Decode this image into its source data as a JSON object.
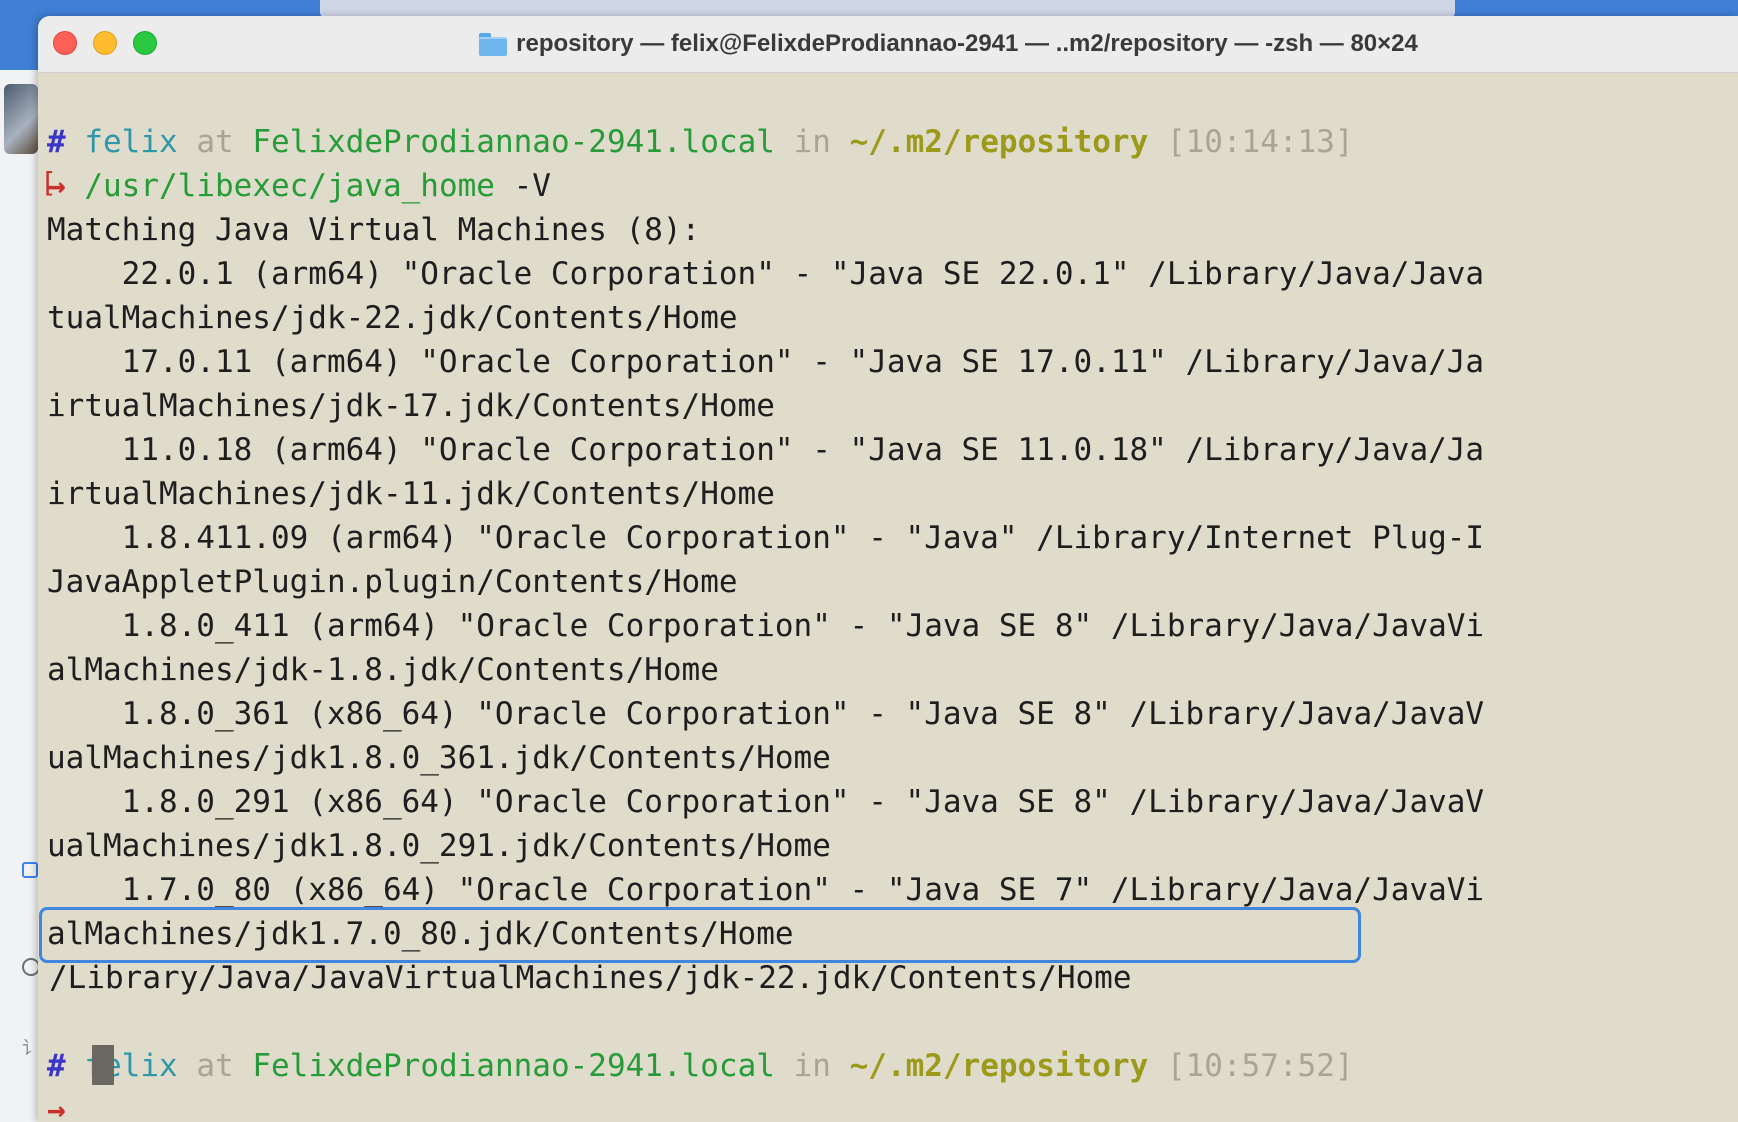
{
  "window": {
    "title": "repository — felix@FelixdeProdiannao-2941 — ..m2/repository — -zsh — 80×24",
    "folder_icon": "folder-icon"
  },
  "colors": {
    "terminal_bg": "#dfdccb",
    "prompt_hash": "#3b35c9",
    "user": "#2f97a8",
    "host": "#279b3a",
    "path": "#9c9a1b",
    "arrow": "#c8322a",
    "highlight_border": "#3f86e0"
  },
  "prompt1": {
    "hash": "#",
    "user": "felix",
    "at": "at",
    "host": "FelixdeProdiannao-2941.local",
    "in": "in",
    "path": "~/.m2/repository",
    "time": "[10:14:13]"
  },
  "command": {
    "arrow": "→",
    "text": "/usr/libexec/java_home",
    "args": "-V"
  },
  "output": [
    "Matching Java Virtual Machines (8):",
    "    22.0.1 (arm64) \"Oracle Corporation\" - \"Java SE 22.0.1\" /Library/Java/Java",
    "tualMachines/jdk-22.jdk/Contents/Home",
    "    17.0.11 (arm64) \"Oracle Corporation\" - \"Java SE 17.0.11\" /Library/Java/Ja",
    "irtualMachines/jdk-17.jdk/Contents/Home",
    "    11.0.18 (arm64) \"Oracle Corporation\" - \"Java SE 11.0.18\" /Library/Java/Ja",
    "irtualMachines/jdk-11.jdk/Contents/Home",
    "    1.8.411.09 (arm64) \"Oracle Corporation\" - \"Java\" /Library/Internet Plug-I",
    "JavaAppletPlugin.plugin/Contents/Home",
    "    1.8.0_411 (arm64) \"Oracle Corporation\" - \"Java SE 8\" /Library/Java/JavaVi",
    "alMachines/jdk-1.8.jdk/Contents/Home",
    "    1.8.0_361 (x86_64) \"Oracle Corporation\" - \"Java SE 8\" /Library/Java/JavaV",
    "ualMachines/jdk1.8.0_361.jdk/Contents/Home",
    "    1.8.0_291 (x86_64) \"Oracle Corporation\" - \"Java SE 8\" /Library/Java/JavaV",
    "ualMachines/jdk1.8.0_291.jdk/Contents/Home",
    "    1.7.0_80 (x86_64) \"Oracle Corporation\" - \"Java SE 7\" /Library/Java/JavaVi",
    "alMachines/jdk1.7.0_80.jdk/Contents/Home"
  ],
  "result": "/Library/Java/JavaVirtualMachines/jdk-22.jdk/Contents/Home",
  "prompt2": {
    "hash": "#",
    "user": "felix",
    "at": "at",
    "host": "FelixdeProdiannao-2941.local",
    "in": "in",
    "path": "~/.m2/repository",
    "time": "[10:57:52]",
    "arrow": "→"
  },
  "sidebar": {
    "partial_char": "讠"
  }
}
